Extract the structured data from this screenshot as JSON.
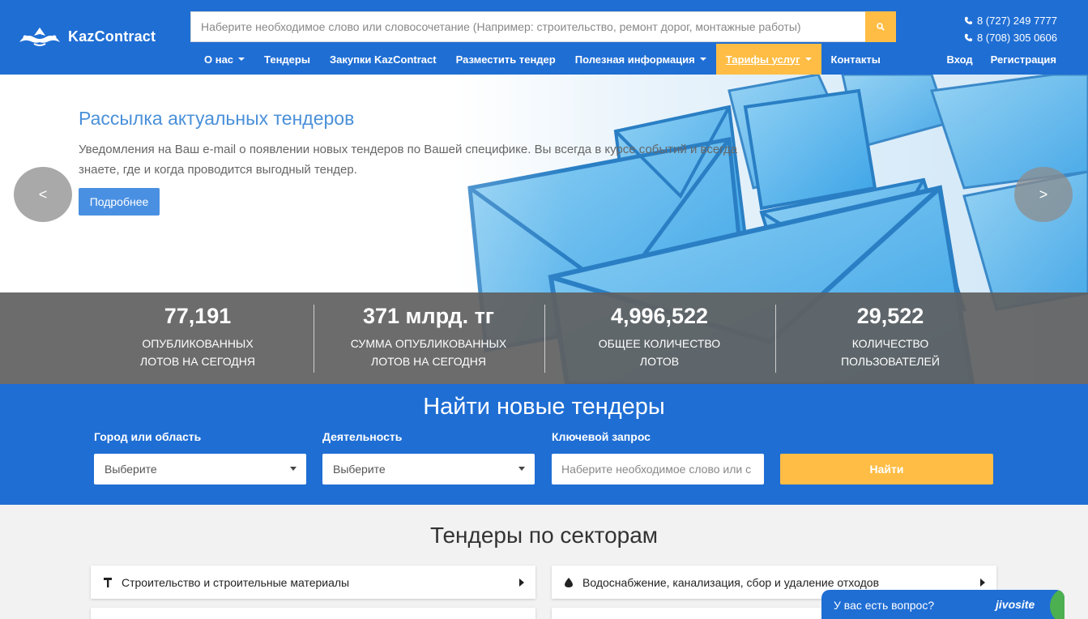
{
  "header": {
    "logo_text": "KazContract",
    "search_placeholder": "Наберите необходимое слово или словосочетание (Например: строительство, ремонт дорог, монтажные работы)",
    "phones": [
      "8 (727) 249 7777",
      "8 (708) 305 0606"
    ],
    "nav": [
      {
        "label": "О нас",
        "dropdown": true
      },
      {
        "label": "Тендеры",
        "dropdown": false
      },
      {
        "label": "Закупки KazContract",
        "dropdown": false
      },
      {
        "label": "Разместить тендер",
        "dropdown": false
      },
      {
        "label": "Полезная информация",
        "dropdown": true
      },
      {
        "label": "Тарифы услуг",
        "dropdown": true,
        "active": true
      },
      {
        "label": "Контакты",
        "dropdown": false
      }
    ],
    "login": "Вход",
    "register": "Регистрация"
  },
  "hero": {
    "title": "Рассылка актуальных тендеров",
    "text": "Уведомления на Ваш e-mail о появлении новых тендеров по Вашей специфике. Вы всегда в курсе событий и всегда знаете, где и когда проводится выгодный тендер.",
    "button": "Подробнее",
    "prev": "<",
    "next": ">"
  },
  "stats": [
    {
      "value": "77,191",
      "label_1": "ОПУБЛИКОВАННЫХ",
      "label_2": "ЛОТОВ НА СЕГОДНЯ"
    },
    {
      "value": "371 млрд. тг",
      "label_1": "СУММА ОПУБЛИКОВАННЫХ",
      "label_2": "ЛОТОВ НА СЕГОДНЯ"
    },
    {
      "value": "4,996,522",
      "label_1": "ОБЩЕЕ КОЛИЧЕСТВО",
      "label_2": "ЛОТОВ"
    },
    {
      "value": "29,522",
      "label_1": "КОЛИЧЕСТВО",
      "label_2": "ПОЛЬЗОВАТЕЛЕЙ"
    }
  ],
  "find": {
    "title": "Найти новые тендеры",
    "city_label": "Город или область",
    "city_value": "Выберите",
    "activity_label": "Деятельность",
    "activity_value": "Выберите",
    "keyword_label": "Ключевой запрос",
    "keyword_placeholder": "Наберите необходимое слово или с",
    "button": "Найти"
  },
  "sectors": {
    "title": "Тендеры по секторам",
    "items": [
      {
        "label": "Строительство и строительные материалы",
        "icon": "hammer-icon"
      },
      {
        "label": "Водоснабжение, канализация, сбор и удаление отходов",
        "icon": "water-drop-icon"
      }
    ]
  },
  "chat": {
    "text": "У вас есть вопрос?",
    "brand": "jivosite"
  },
  "colors": {
    "primary": "#1f6ed4",
    "accent": "#ffbd45",
    "hero_title": "#4a90d9",
    "hero_button": "#4a90e2"
  }
}
